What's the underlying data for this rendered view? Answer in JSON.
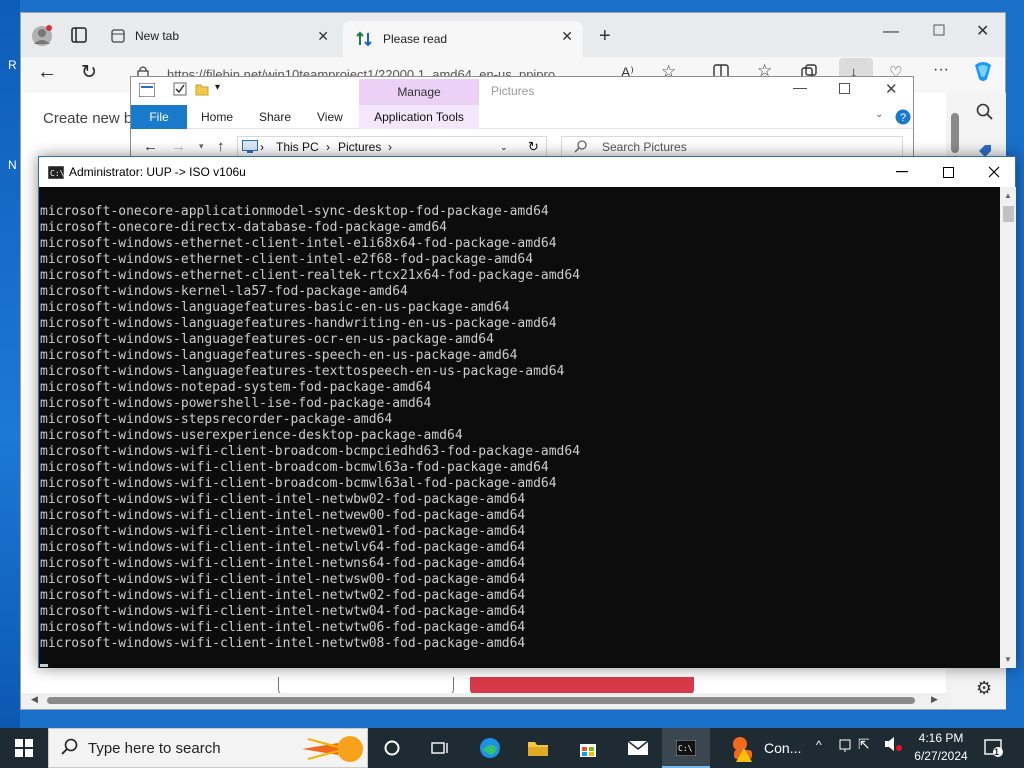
{
  "desktop": {
    "letters": [
      "R",
      "N"
    ]
  },
  "browser": {
    "tabs": [
      {
        "label": "New tab"
      },
      {
        "label": "Please read"
      }
    ],
    "url": "https://filebin.net/win10teamproject1/22000.1_amd64_en-us_ppipro ...",
    "page_text": "Create new b"
  },
  "explorer": {
    "context_tab": "Manage",
    "title": "Pictures",
    "ribbon_tabs": [
      "File",
      "Home",
      "Share",
      "View",
      "Application Tools"
    ],
    "breadcrumb": [
      "This PC",
      "Pictures"
    ],
    "search_placeholder": "Search Pictures"
  },
  "cmd": {
    "title": "Administrator:  UUP -> ISO v106u",
    "lines": [
      "microsoft-onecore-applicationmodel-sync-desktop-fod-package-amd64",
      "microsoft-onecore-directx-database-fod-package-amd64",
      "microsoft-windows-ethernet-client-intel-e1i68x64-fod-package-amd64",
      "microsoft-windows-ethernet-client-intel-e2f68-fod-package-amd64",
      "microsoft-windows-ethernet-client-realtek-rtcx21x64-fod-package-amd64",
      "microsoft-windows-kernel-la57-fod-package-amd64",
      "microsoft-windows-languagefeatures-basic-en-us-package-amd64",
      "microsoft-windows-languagefeatures-handwriting-en-us-package-amd64",
      "microsoft-windows-languagefeatures-ocr-en-us-package-amd64",
      "microsoft-windows-languagefeatures-speech-en-us-package-amd64",
      "microsoft-windows-languagefeatures-texttospeech-en-us-package-amd64",
      "microsoft-windows-notepad-system-fod-package-amd64",
      "microsoft-windows-powershell-ise-fod-package-amd64",
      "microsoft-windows-stepsrecorder-package-amd64",
      "microsoft-windows-userexperience-desktop-package-amd64",
      "microsoft-windows-wifi-client-broadcom-bcmpciedhd63-fod-package-amd64",
      "microsoft-windows-wifi-client-broadcom-bcmwl63a-fod-package-amd64",
      "microsoft-windows-wifi-client-broadcom-bcmwl63al-fod-package-amd64",
      "microsoft-windows-wifi-client-intel-netwbw02-fod-package-amd64",
      "microsoft-windows-wifi-client-intel-netwew00-fod-package-amd64",
      "microsoft-windows-wifi-client-intel-netwew01-fod-package-amd64",
      "microsoft-windows-wifi-client-intel-netwlv64-fod-package-amd64",
      "microsoft-windows-wifi-client-intel-netwns64-fod-package-amd64",
      "microsoft-windows-wifi-client-intel-netwsw00-fod-package-amd64",
      "microsoft-windows-wifi-client-intel-netwtw02-fod-package-amd64",
      "microsoft-windows-wifi-client-intel-netwtw04-fod-package-amd64",
      "microsoft-windows-wifi-client-intel-netwtw06-fod-package-amd64",
      "microsoft-windows-wifi-client-intel-netwtw08-fod-package-amd64"
    ]
  },
  "taskbar": {
    "search_placeholder": "Type here to search",
    "pinned_label": "Con...",
    "time": "4:16 PM",
    "date": "6/27/2024",
    "notification_count": "1"
  },
  "colors": {
    "taskbar": "#1f2b33",
    "console_bg": "#0c0c0c",
    "console_fg": "#cccccc",
    "ribbon_file": "#1979ca",
    "manage_tab": "#ead1f5"
  }
}
